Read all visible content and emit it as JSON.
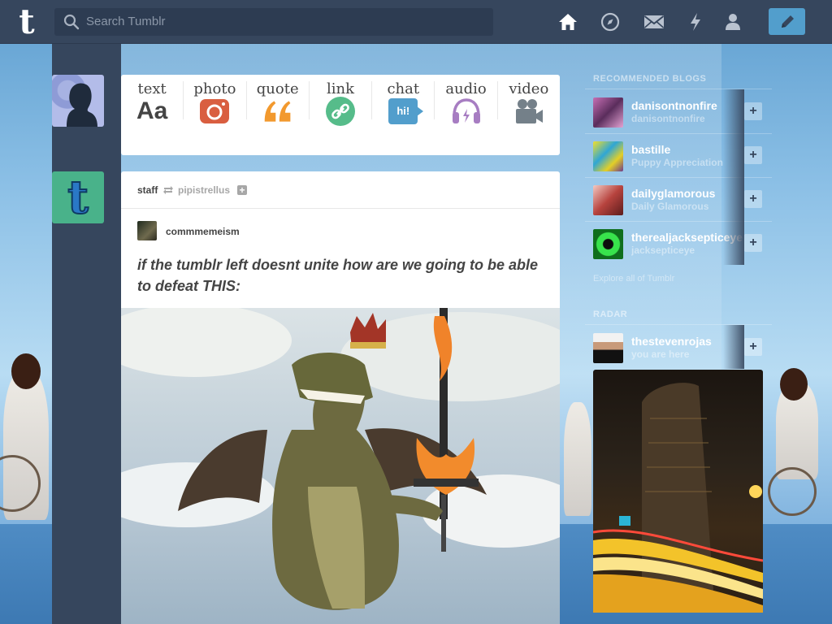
{
  "nav": {
    "search_placeholder": "Search Tumblr",
    "logo_letter": "t",
    "icons": [
      "home-icon",
      "explore-compass-icon",
      "inbox-mail-icon",
      "activity-lightning-icon",
      "account-person-icon",
      "compose-pencil-icon"
    ],
    "accent": "#529ecc",
    "bar_color": "#36465d"
  },
  "post_types": [
    {
      "label": "text",
      "icon": "text-aa-icon",
      "glyph": "Aa",
      "color": "#444444"
    },
    {
      "label": "photo",
      "icon": "photo-camera-icon",
      "color": "#d95e40"
    },
    {
      "label": "quote",
      "icon": "quote-marks-icon",
      "color": "#f2992e"
    },
    {
      "label": "link",
      "icon": "link-chain-icon",
      "color": "#56bc8a"
    },
    {
      "label": "chat",
      "icon": "chat-bubble-icon",
      "glyph": "hi!",
      "color": "#529ecc"
    },
    {
      "label": "audio",
      "icon": "audio-headphones-icon",
      "color": "#a77dc2"
    },
    {
      "label": "video",
      "icon": "video-camera-icon",
      "color": "#748089"
    }
  ],
  "post": {
    "author": "staff",
    "reblogged_from": "pipistrellus",
    "source_blog": "commmemeism",
    "title": "if the tumblr left doesnt unite how are we going to be able to defeat THIS:"
  },
  "sidebar": {
    "recommended_heading": "RECOMMENDED BLOGS",
    "recommended": [
      {
        "name": "danisontnonfire",
        "subtitle": "danisontnonfire"
      },
      {
        "name": "bastille",
        "subtitle": "Puppy Appreciation"
      },
      {
        "name": "dailyglamorous",
        "subtitle": "Daily Glamorous"
      },
      {
        "name": "therealjacksepticeye",
        "subtitle": "jacksepticeye"
      }
    ],
    "explore_link": "Explore all of Tumblr",
    "radar_heading": "RADAR",
    "radar": {
      "name": "thestevenrojas",
      "subtitle": "you are here"
    },
    "follow_symbol": "+"
  }
}
